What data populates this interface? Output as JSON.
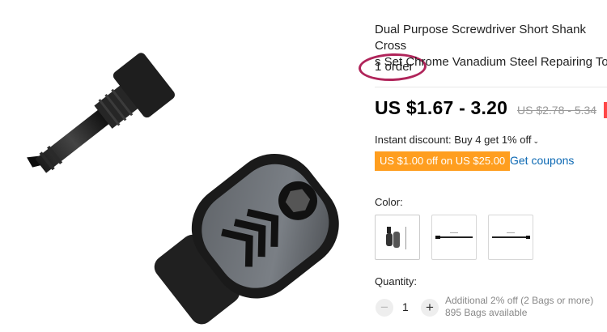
{
  "product": {
    "title_line1": "Dual Purpose Screwdriver Short Shank Cross",
    "title_line2": "s Set Chrome Vanadium Steel Repairing Too",
    "orders": "1 order"
  },
  "pricing": {
    "price": "US $1.67 - 3.20",
    "original_price": "US $2.78 - 5.34",
    "instant_discount": "Instant discount: Buy 4 get 1% off",
    "coupon_badge": "US $1.00 off on US $25.00",
    "get_coupons": "Get coupons"
  },
  "color": {
    "label": "Color:",
    "options": [
      "screwdriver-set-variant",
      "long-bit-variant",
      "long-rod-variant"
    ]
  },
  "quantity": {
    "label": "Quantity:",
    "value": "1",
    "minus": "−",
    "plus": "+",
    "note_line1": "Additional 2% off (2 Bags or more)",
    "note_line2": "895 Bags available"
  },
  "colors": {
    "accent_link": "#0b68b3",
    "coupon_badge_bg": "#ff9e1f",
    "highlight_ring": "#b0245a",
    "discount_tab": "#ff4747"
  }
}
